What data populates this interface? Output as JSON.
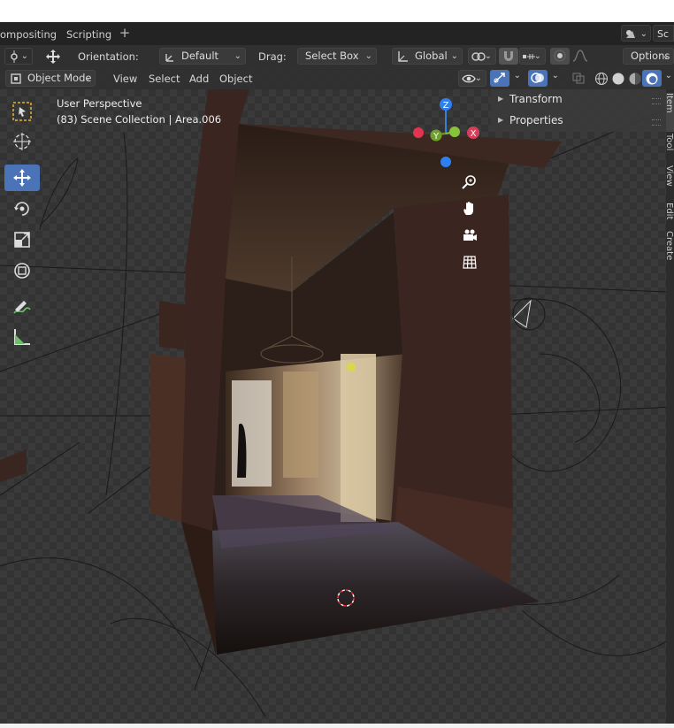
{
  "topbar": {
    "tabs": [
      "ompositing",
      "Scripting"
    ],
    "add_tab": "+",
    "scene_label": "Sc"
  },
  "tool_settings": {
    "orientation_label": "Orientation:",
    "orientation_value": "Default",
    "drag_label": "Drag:",
    "drag_value": "Select Box",
    "transform_orientation": "Global",
    "options_label": "Options"
  },
  "viewport_header": {
    "mode": "Object Mode",
    "menus": [
      "View",
      "Select",
      "Add",
      "Object"
    ]
  },
  "viewport": {
    "perspective": "User Perspective",
    "collection": "(83) Scene Collection | Area.006"
  },
  "gizmo": {
    "axes": [
      "X",
      "Y",
      "Z"
    ],
    "colors": {
      "x": "#d4405a",
      "y": "#6ea02a",
      "z": "#3c7fd8",
      "nx": "#e2344f",
      "ny": "#88c23a",
      "nz": "#2f7ff0"
    }
  },
  "nav_buttons": [
    "zoom-icon",
    "hand-pan-icon",
    "camera-icon",
    "grid-ortho-icon"
  ],
  "toolbar_tools": [
    "select-box-icon",
    "cursor-icon",
    "move-icon",
    "rotate-icon",
    "scale-icon",
    "transform-icon",
    "annotate-icon",
    "measure-icon"
  ],
  "n_panel": {
    "sections": [
      "Transform",
      "Properties"
    ],
    "tabs": [
      "Item",
      "Tool",
      "View",
      "Edit",
      "Create"
    ]
  },
  "colors": {
    "active_tool": "#4a73b8",
    "header_bg": "#303030"
  }
}
